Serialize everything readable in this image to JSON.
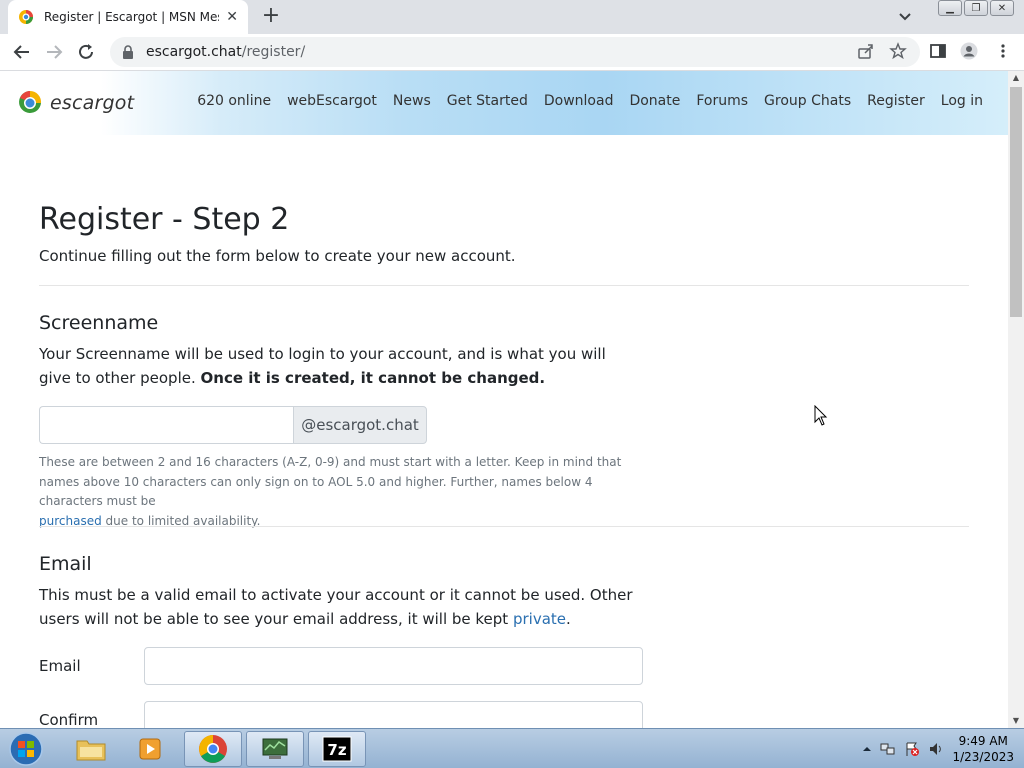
{
  "browser": {
    "tab_title": "Register | Escargot | MSN Messe",
    "url_host": "escargot.chat",
    "url_path": "/register/"
  },
  "site": {
    "logo_text": "escargot",
    "nav": [
      "620 online",
      "webEscargot",
      "News",
      "Get Started",
      "Download",
      "Donate",
      "Forums",
      "Group Chats",
      "Register",
      "Log in"
    ]
  },
  "page": {
    "title": "Register - Step 2",
    "lead": "Continue filling out the form below to create your new account.",
    "screenname": {
      "heading": "Screenname",
      "desc_plain": "Your Screenname will be used to login to your account, and is what you will give to other people.",
      "desc_bold": "Once it is created, it cannot be changed.",
      "input_value": "",
      "suffix": "@escargot.chat",
      "help_pre": "These are between 2 and 16 characters (A-Z, 0-9) and must start with a letter. Keep in mind that names above 10 characters can only sign on to AOL 5.0 and higher. Further, names below 4 characters must be",
      "help_link": "purchased",
      "help_post": "due to limited availability."
    },
    "email": {
      "heading": "Email",
      "desc_pre": "This must be a valid email to activate your account or it cannot be used. Other users will not be able to see your email address, it will be kept",
      "desc_link": "private",
      "desc_post": ".",
      "email_label": "Email",
      "confirm_label": "Confirm",
      "email_value": "",
      "confirm_value": ""
    }
  },
  "taskbar": {
    "time": "9:49 AM",
    "date": "1/23/2023"
  }
}
